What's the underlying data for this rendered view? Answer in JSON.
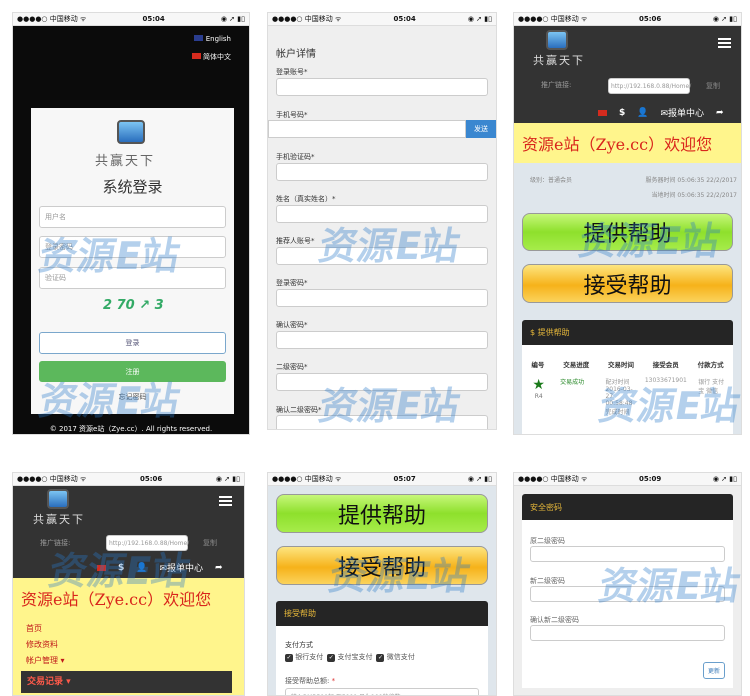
{
  "status": {
    "carrier": "●●●●○ 中国移动 ᯤ",
    "battery": "◉ ➚ ▮▯"
  },
  "login": {
    "time": "05:04",
    "lang_en": "English",
    "lang_cn": "简体中文",
    "brand": "共赢天下",
    "title": "系统登录",
    "username_ph": "用户名",
    "password_ph": "登录密码",
    "captcha_ph": "验证码",
    "captcha": "2 70 ↗ 3",
    "login_btn": "登录",
    "register_btn": "注册",
    "forgot": "忘记密码",
    "footer": "© 2017 资源e站（Zye.cc）. All rights reserved."
  },
  "register": {
    "time": "05:04",
    "title": "帐户详情",
    "fields": [
      "登录账号*",
      "手机号码*",
      "手机验证码*",
      "姓名（真实姓名）*",
      "推荐人账号*",
      "登录密码*",
      "确认密码*",
      "二级密码*",
      "确认二级密码*"
    ],
    "send_btn": "发送"
  },
  "home": {
    "time": "05:06",
    "brand": "共赢天下",
    "promo_label": "推广链接:",
    "promo_url": "http://192.168.0.88/Home/",
    "copy": "复制",
    "report_center": "报单中心",
    "welcome": "资源e站（Zye.cc）欢迎您",
    "level": "级别：普通会员",
    "server_time": "服务器时间  05:06:35 22/2/2017",
    "local_time": "当地时间  05:06:35 22/2/2017",
    "offer_help": "提供帮助",
    "accept_help": "接受帮助",
    "panel_title": "$ 提供帮助",
    "table_headers": [
      "编号",
      "交易进度",
      "交易时间",
      "接受会员",
      "付款方式"
    ],
    "row": {
      "id": "R4",
      "status": "交易成功",
      "time": "配对时间 2016-03-27 00:58:48 完成时间",
      "member": "13033671901",
      "pay": "银行 支付宝 微信"
    }
  },
  "menu": {
    "time": "05:06",
    "items": [
      "首页",
      "修改资料",
      "帐户管理 ▾",
      "交易记录 ▾"
    ]
  },
  "accept": {
    "time": "05:07",
    "offer_help": "提供帮助",
    "accept_help": "接受帮助",
    "panel_title": "接受帮助",
    "pay_label": "支付方式",
    "options": [
      "银行支付",
      "支付宝支付",
      "微信支付"
    ],
    "amount_label": "接受帮助总额:",
    "required": "*",
    "amount_ph": "输入RMB500起 至5000 且为100的倍数"
  },
  "security": {
    "time": "05:09",
    "panel_title": "安全密码",
    "fields": [
      "原二级密码",
      "新二级密码",
      "确认新二级密码"
    ],
    "update_btn": "更新"
  },
  "watermark": "资源E站"
}
